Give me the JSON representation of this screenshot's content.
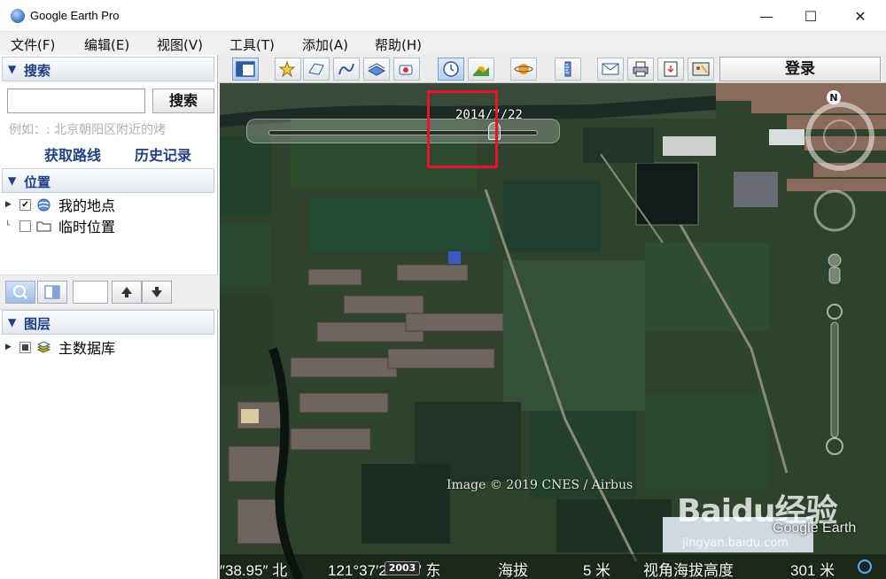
{
  "window": {
    "title": "Google Earth Pro",
    "minimize": "—",
    "maximize": "☐",
    "close": "✕"
  },
  "menu": [
    "文件(F)",
    "编辑(E)",
    "视图(V)",
    "工具(T)",
    "添加(A)",
    "帮助(H)"
  ],
  "search": {
    "header": "搜索",
    "input_value": "",
    "button": "搜索",
    "example": "例如：: 北京朝阳区附近的烤",
    "get_directions": "获取路线",
    "history": "历史记录"
  },
  "places": {
    "header": "位置",
    "items": [
      {
        "label": "我的地点",
        "checked": true,
        "icon": "globe-icon"
      },
      {
        "label": "临时位置",
        "checked": false,
        "icon": "folder-icon"
      }
    ]
  },
  "layers": {
    "header": "图层",
    "items": [
      {
        "label": "主数据库",
        "icon": "layers-stack-icon"
      }
    ]
  },
  "toolbar": {
    "login": "登录",
    "buttons": [
      "sidebar-toggle-icon",
      "placemark-icon",
      "polygon-icon",
      "path-icon",
      "image-overlay-icon",
      "record-tour-icon",
      "historical-imagery-icon",
      "sunlight-icon",
      "planets-icon",
      "ruler-icon",
      "email-icon",
      "print-icon",
      "save-image-icon",
      "maps-icon"
    ]
  },
  "map": {
    "slider_date": "2014/7/22",
    "slider_position": 0.84,
    "image_credit": "Image © 2019 CNES / Airbus",
    "watermark_brand": "Baidu经验",
    "watermark_url": "jingyan.baidu.com",
    "logo": "Google Earth",
    "compass_label": "N"
  },
  "status": {
    "lat": "″38.95″ 北",
    "lon": "121°37′23.19″ 东",
    "year": "2003",
    "elevation_label": "海拔",
    "elevation_value": "5 米",
    "eye_alt_label": "视角海拔高度",
    "eye_alt_value": "301 米"
  },
  "colors": {
    "highlight": "#e8152a",
    "link": "#1d3f86"
  }
}
